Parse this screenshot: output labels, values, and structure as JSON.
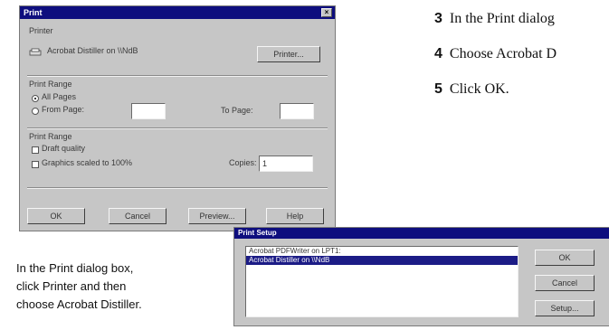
{
  "print_dialog": {
    "title": "Print",
    "close_glyph": "×",
    "printer_section_label": "Printer",
    "printer_name": "Acrobat Distiller on \\\\NdB",
    "printer_button": "Printer...",
    "print_range_label": "Print Range",
    "all_pages": "All Pages",
    "from_page": "From Page:",
    "from_value": "",
    "to_page": "To Page:",
    "to_value": "",
    "print_range2_label": "Print Range",
    "draft_quality": "Draft quality",
    "graphics_scaled": "Graphics scaled to 100%",
    "copies_label": "Copies:",
    "copies_value": "1",
    "ok_button": "OK",
    "cancel_button": "Cancel",
    "preview_button": "Preview...",
    "help_button": "Help"
  },
  "steps": [
    {
      "num": "3",
      "text": "In the Print dialog"
    },
    {
      "num": "4",
      "text": "Choose Acrobat D"
    },
    {
      "num": "5",
      "text": "Click OK."
    }
  ],
  "caption": {
    "line1": "In the Print dialog box,",
    "line2": "click Printer and then",
    "line3": "choose Acrobat Distiller."
  },
  "setup_dialog": {
    "title": "Print Setup",
    "printers": [
      "Acrobat PDFWriter on LPT1:",
      "Acrobat Distiller on \\\\NdB"
    ],
    "ok_button": "OK",
    "cancel_button": "Cancel",
    "setup_button": "Setup..."
  }
}
